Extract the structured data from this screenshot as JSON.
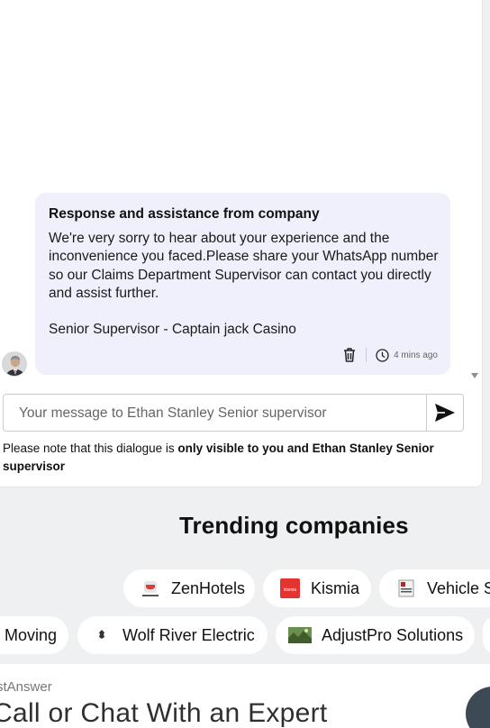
{
  "chat": {
    "response_title": "Response and assistance from company",
    "response_body": "We're very sorry to hear about your experience and the inconvenience you faced.Please share your WhatsApp number so our Claims Department Supervisor can contact you directly and assist further.\n\nSenior Supervisor - Captain jack Casino",
    "timestamp": "4 mins ago",
    "input_placeholder": "Your message to Ethan Stanley Senior supervisor",
    "note_prefix": "Please note that this dialogue is ",
    "note_bold": "only visible to you and Ethan Stanley Senior supervisor"
  },
  "trending": {
    "title": "Trending companies",
    "row1": [
      {
        "name": "ZenHotels",
        "logo_color": "#e8e8e8"
      },
      {
        "name": "Kismia",
        "logo_color": "#e3342f"
      },
      {
        "name": "Vehicle S",
        "logo_color": "#b22"
      }
    ],
    "row2": [
      {
        "name": "Moving",
        "logo_color": ""
      },
      {
        "name": "Wolf River Electric",
        "logo_color": "#333"
      },
      {
        "name": "AdjustPro Solutions",
        "logo_color": "#4a7a3a"
      }
    ]
  },
  "footer": {
    "brand": "stAnswer",
    "cta": "Call or Chat With an Expert"
  },
  "colors": {
    "bubble_bg": "#eff0fb",
    "page_bg": "#eef0f2",
    "fab": "#3d4a56"
  }
}
